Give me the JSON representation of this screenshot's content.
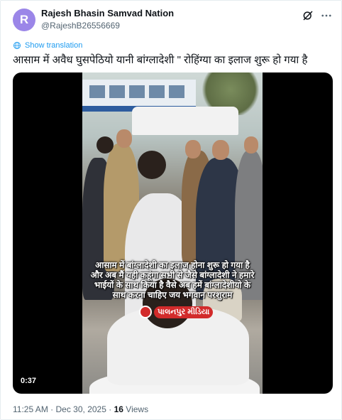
{
  "author": {
    "avatar_letter": "R",
    "avatar_color": "#9b86e8",
    "display_name": "Rajesh Bhasin Samvad Nation",
    "handle": "@RajeshB26556669"
  },
  "header_icons": [
    "grok-icon",
    "more-options-icon"
  ],
  "translate": {
    "label": "Show translation",
    "icon": "globe-icon"
  },
  "tweet_text": "आसाम में अवैध घुसपेठियो यानी बांग्लादेशी \" रोहिंग्या का इलाज शुरू हो गया है",
  "video": {
    "caption_lines": [
      "आसाम में बांग्लादेशी का इलाज होना शुरू हो गया है",
      "और अब मैं यही कहूंगा सभी से जैसे बांग्लादेशी ने हमारे",
      "भाईयों के साथ किया है वैसे अब हमें बांग्लादेशीयो के",
      "साथ करना चाहिए जय भगवान परशुराम"
    ],
    "brand_name": "પાલનપુર મીડિયા",
    "brand_color": "#d22b2b",
    "timer": "0:37"
  },
  "meta": {
    "time": "11:25 AM",
    "separator": "·",
    "date": "Dec 30, 2025",
    "views_count": "16",
    "views_label": "Views"
  },
  "accent_color": "#1d9bf0"
}
